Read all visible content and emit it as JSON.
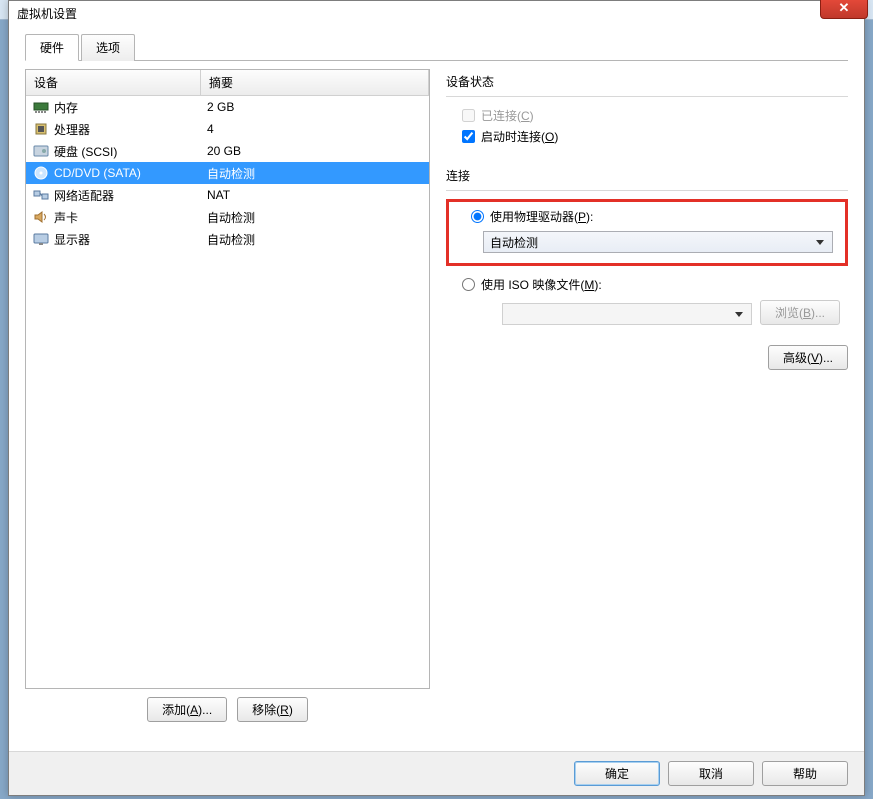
{
  "dialog": {
    "title": "虚拟机设置"
  },
  "tabs": {
    "hardware": "硬件",
    "options": "选项"
  },
  "table": {
    "col_device": "设备",
    "col_summary": "摘要"
  },
  "devices": [
    {
      "name": "内存",
      "summary": "2 GB",
      "icon": "memory"
    },
    {
      "name": "处理器",
      "summary": "4",
      "icon": "cpu"
    },
    {
      "name": "硬盘 (SCSI)",
      "summary": "20 GB",
      "icon": "disk"
    },
    {
      "name": "CD/DVD (SATA)",
      "summary": "自动检测",
      "icon": "cd",
      "selected": true
    },
    {
      "name": "网络适配器",
      "summary": "NAT",
      "icon": "net"
    },
    {
      "name": "声卡",
      "summary": "自动检测",
      "icon": "sound"
    },
    {
      "name": "显示器",
      "summary": "自动检测",
      "icon": "display"
    }
  ],
  "buttons": {
    "add": "添加(A)...",
    "add_key": "A",
    "remove": "移除(R)",
    "remove_key": "R",
    "browse": "浏览(B)...",
    "browse_key": "B",
    "advanced": "高级(V)...",
    "advanced_key": "V",
    "ok": "确定",
    "cancel": "取消",
    "help": "帮助"
  },
  "right": {
    "status_title": "设备状态",
    "connected": "已连接(C)",
    "connected_key": "C",
    "connect_at_power": "启动时连接(O)",
    "connect_at_power_key": "O",
    "connection_title": "连接",
    "use_physical": "使用物理驱动器(P):",
    "use_physical_key": "P",
    "physical_value": "自动检测",
    "use_iso": "使用 ISO 映像文件(M):",
    "use_iso_key": "M",
    "iso_value": ""
  }
}
